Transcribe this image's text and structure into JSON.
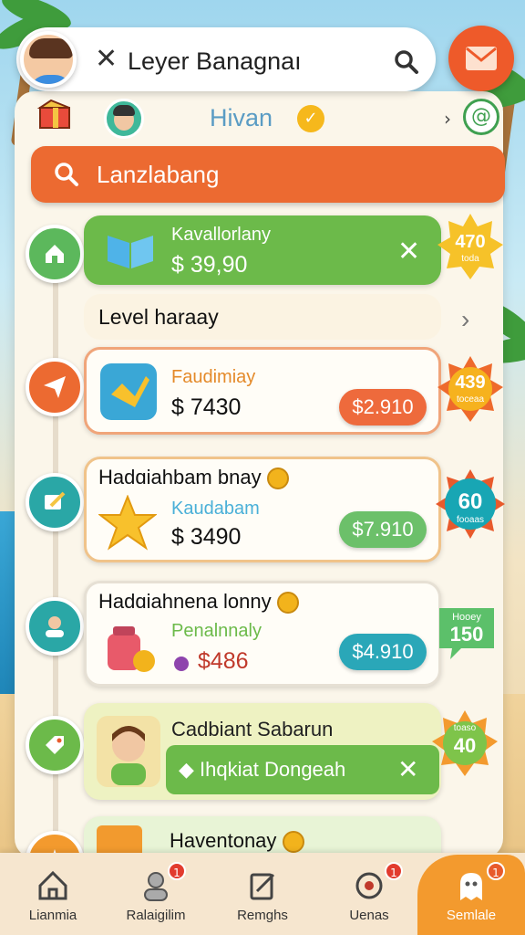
{
  "colors": {
    "orange": "#ec6a31",
    "green": "#6cba4a",
    "teal": "#2aa7a6",
    "card_bg": "#fffdf7"
  },
  "topbar": {
    "close_icon": "close-icon",
    "title": "Leyer Banagnaı",
    "search_icon": "search-icon"
  },
  "mail_button": {
    "icon": "mail-icon"
  },
  "header": {
    "name": "Hivan",
    "badge": "✓"
  },
  "search": {
    "placeholder": "Lanzlabang"
  },
  "section_row": {
    "title": "Level haraay"
  },
  "items": [
    {
      "title": "Kavallorlany",
      "price": "$ 39,90",
      "badge_value": "470",
      "badge_sub": "toda",
      "action_icon": "close-icon",
      "node_icon": "home-icon"
    },
    {
      "title": "Faudimiay",
      "price": "$ 7430",
      "pill": "$2.910",
      "badge_value": "439",
      "badge_sub": "toceaa",
      "node_icon": "send-icon"
    },
    {
      "header": "Hadɑiahbam bnay",
      "title": "Kaudabam",
      "price": "$ 3490",
      "pill": "$7.910",
      "badge_value": "60",
      "badge_sub": "fooaas",
      "node_icon": "edit-icon"
    },
    {
      "header": "Hadɑiahnena lonny",
      "title": "Penalnnaly",
      "price": "$486",
      "pill": "$4.910",
      "badge_value": "150",
      "badge_sub": "Hooey",
      "node_icon": "user-icon"
    },
    {
      "title": "Cadbiant Sabarun",
      "action": "Ihqkiat Dongeah",
      "badge_value": "40",
      "badge_sub": "toaso",
      "node_icon": "tag-icon"
    },
    {
      "title": "Haventonay",
      "node_icon": "star-icon"
    }
  ],
  "bottom_nav": [
    {
      "label": "Lianmia",
      "icon": "home-icon"
    },
    {
      "label": "Ralaigilim",
      "icon": "profile-icon",
      "badge": "1"
    },
    {
      "label": "Remghs",
      "icon": "edit-icon"
    },
    {
      "label": "Uenas",
      "icon": "bug-icon",
      "badge": "1"
    },
    {
      "label": "Semlale",
      "icon": "ghost-icon",
      "badge": "1"
    }
  ]
}
